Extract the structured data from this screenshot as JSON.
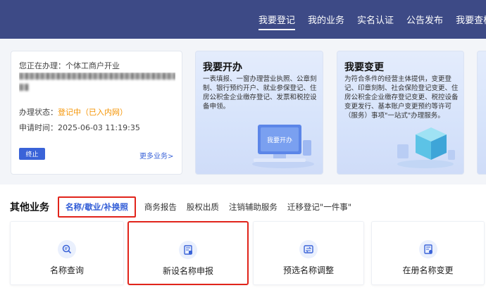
{
  "nav": {
    "items": [
      {
        "label": "我要登记",
        "active": true
      },
      {
        "label": "我的业务",
        "active": false
      },
      {
        "label": "实名认证",
        "active": false
      },
      {
        "label": "公告发布",
        "active": false
      },
      {
        "label": "我要查样",
        "active": false
      }
    ]
  },
  "status_card": {
    "current_label": "您正在办理：个体工商户开业",
    "state_label": "办理状态：",
    "state_value": "登记中（已入内网）",
    "time_label": "申请时间：",
    "time_value": "2025-06-03 11:19:35",
    "stop_button": "终止",
    "more_link": "更多业务>"
  },
  "promos": [
    {
      "title": "我要开办",
      "desc": "一表填报、一窗办理营业执照、公章刻制、银行预约开户、就业参保登记、住房公积金企业缴存登记、发票和税控设备申领。",
      "illustration_text": "我要开办"
    },
    {
      "title": "我要变更",
      "desc": "为符合条件的经营主体提供，变更登记、印章刻制、社会保险登记变更、住房公积金企业缴存登记变更、税控设备变更发行、基本账户变更预约等许可（服务）事项\"一站式\"办理服务。"
    }
  ],
  "other_business": {
    "title": "其他业务",
    "tabs": [
      {
        "label": "名称/歇业/补换照",
        "active": true
      },
      {
        "label": "商务报告",
        "active": false
      },
      {
        "label": "股权出质",
        "active": false
      },
      {
        "label": "注销辅助服务",
        "active": false
      },
      {
        "label": "迁移登记\"一件事\"",
        "active": false
      }
    ],
    "tiles": [
      {
        "label": "名称查询",
        "icon": "name-search-icon"
      },
      {
        "label": "新设名称申报",
        "icon": "name-apply-icon"
      },
      {
        "label": "预选名称调整",
        "icon": "name-adjust-icon"
      },
      {
        "label": "在册名称变更",
        "icon": "name-change-icon"
      }
    ]
  },
  "colors": {
    "topbar": "#3d4a86",
    "accent": "#3a63d8",
    "status_highlight": "#f59300",
    "annotation_red": "#e1241b"
  }
}
